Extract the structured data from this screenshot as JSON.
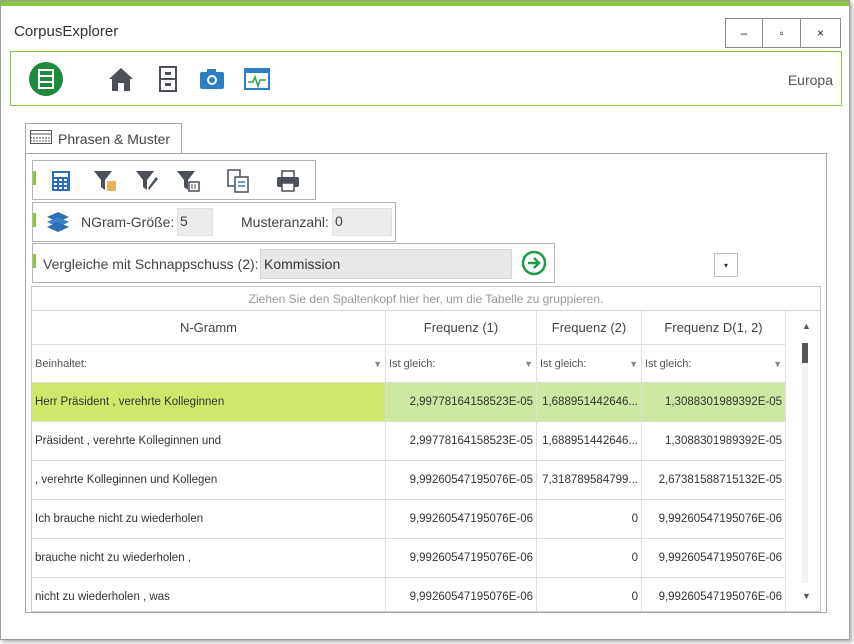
{
  "window": {
    "title": "CorpusExplorer",
    "minimize_glyph": "‒",
    "maximize_glyph": "▫",
    "close_glyph": "×",
    "accent_color": "#8dc63f"
  },
  "toolbar": {
    "icons": [
      "database-icon",
      "home-icon",
      "cabinet-icon",
      "camera-icon",
      "monitor-icon"
    ],
    "region_label": "Europa"
  },
  "tab": {
    "label": "Phrasen & Muster",
    "icon": "table-icon"
  },
  "action_bar": {
    "icons": [
      "calculator-icon",
      "filter-add-icon",
      "filter-edit-icon",
      "filter-clear-icon",
      "export-icon",
      "print-icon"
    ]
  },
  "ngram_bar": {
    "icon": "layers-icon",
    "size_label": "NGram-Größe:",
    "size_value": "5",
    "pattern_count_label": "Musteranzahl:",
    "pattern_count_value": "0"
  },
  "compare_bar": {
    "label": "Vergleiche mit Schnappschuss (2):",
    "selected_option": "Kommission",
    "dropdown_glyph": "▾",
    "go_icon": "arrow-right-circle-icon"
  },
  "grid": {
    "group_hint": "Ziehen Sie den Spaltenkopf hier her, um die Tabelle zu gruppieren.",
    "columns": [
      "N-Gramm",
      "Frequenz (1)",
      "Frequenz (2)",
      "Frequenz D(1, 2)"
    ],
    "filters": [
      "Beinhaltet:",
      "Ist gleich:",
      "Ist gleich:",
      "Ist gleich:"
    ],
    "filter_glyph": "▼",
    "rows": [
      {
        "ngram": "Herr Präsident , verehrte Kolleginnen",
        "f1": "2,99778164158523E-05",
        "f2": "1,688951442646...",
        "fd": "1,3088301989392E-05",
        "selected": true
      },
      {
        "ngram": "Präsident , verehrte Kolleginnen und",
        "f1": "2,99778164158523E-05",
        "f2": "1,688951442646...",
        "fd": "1,3088301989392E-05",
        "selected": false
      },
      {
        "ngram": ", verehrte Kolleginnen und Kollegen",
        "f1": "9,99260547195076E-05",
        "f2": "7,318789584799...",
        "fd": "2,67381588715132E-05",
        "selected": false
      },
      {
        "ngram": "Ich brauche nicht zu wiederholen",
        "f1": "9,99260547195076E-06",
        "f2": "0",
        "fd": "9,99260547195076E-06",
        "selected": false
      },
      {
        "ngram": "brauche nicht zu wiederholen ,",
        "f1": "9,99260547195076E-06",
        "f2": "0",
        "fd": "9,99260547195076E-06",
        "selected": false
      },
      {
        "ngram": "nicht zu wiederholen , was",
        "f1": "9,99260547195076E-06",
        "f2": "0",
        "fd": "9,99260547195076E-06",
        "selected": false
      }
    ],
    "scroll_up_glyph": "▲",
    "scroll_down_glyph": "▼",
    "selection_color": "#cfe86c"
  }
}
